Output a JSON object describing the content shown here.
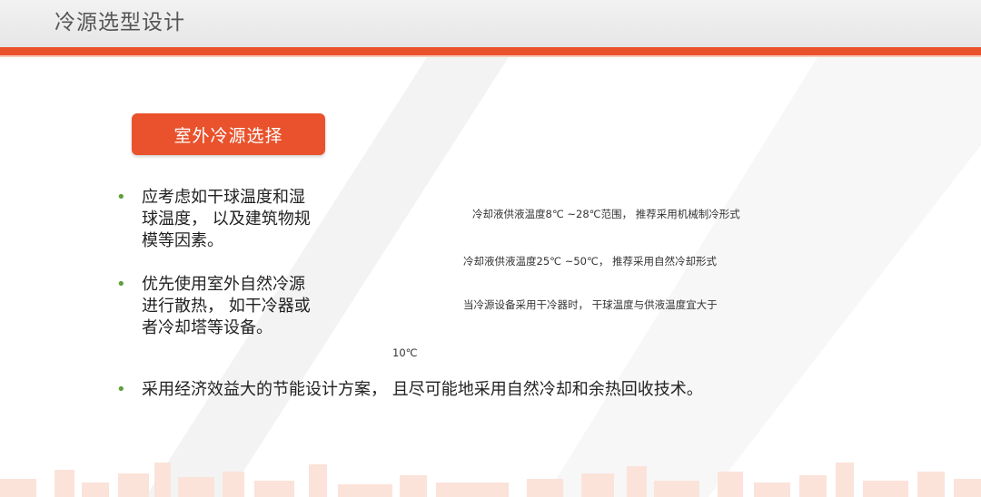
{
  "header": {
    "title": "冷源选型设计"
  },
  "section": {
    "button_label": "室外冷源选择"
  },
  "bullets": [
    {
      "lines": [
        "应考虑如干球温度和湿",
        "球温度，  以及建筑物规",
        "模等因素。"
      ]
    },
    {
      "lines": [
        "优先使用室外自然冷源",
        "进行散热，  如干冷器或",
        "者冷却塔等设备。"
      ]
    },
    {
      "lines": [
        "采用经济效益大的节能设计方案，   且尽可能地采用自然冷却和余热回收技术。"
      ]
    }
  ],
  "notes": {
    "n1": "冷却液供液温度8℃ ~28℃范围，   推荐采用机械制冷形式",
    "n2": "冷却液供液温度25℃ ~50℃，   推荐采用自然冷却形式",
    "n3": "当冷源设备采用干冷器时，   干球温度与供液温度宜大于",
    "n4": "10℃"
  },
  "icons": {
    "bullet": "•"
  },
  "colors": {
    "accent": "#e9522c",
    "bullet": "#5aa13a",
    "header_bg": "#eeeeee"
  }
}
